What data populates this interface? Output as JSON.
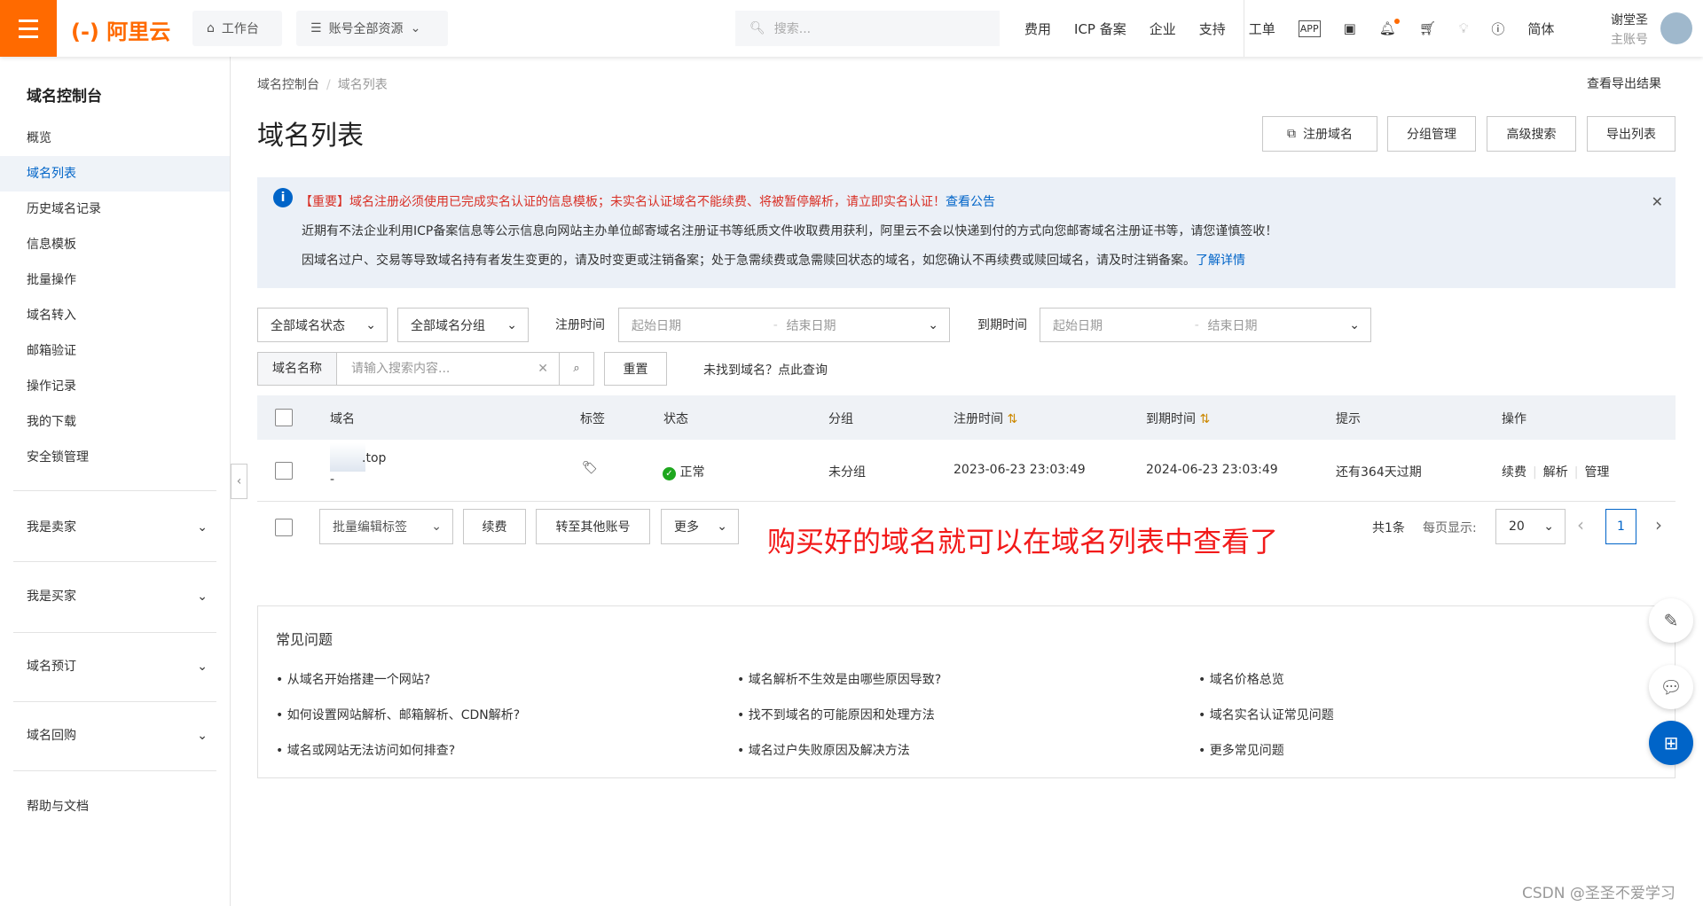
{
  "topbar": {
    "logo": "阿里云",
    "workbench": "工作台",
    "resources": "账号全部资源",
    "search_placeholder": "搜索...",
    "nav": [
      "费用",
      "ICP 备案",
      "企业",
      "支持",
      "工单"
    ],
    "lang": "简体",
    "user_name": "谢堂圣",
    "user_role": "主账号",
    "accent": "#ff6a00"
  },
  "sidebar": {
    "title": "域名控制台",
    "items": [
      "概览",
      "域名列表",
      "历史域名记录",
      "信息模板",
      "批量操作",
      "域名转入",
      "邮箱验证",
      "操作记录",
      "我的下载",
      "安全锁管理"
    ],
    "active": "域名列表",
    "groups": [
      "我是卖家",
      "我是买家",
      "域名预订",
      "域名回购"
    ],
    "help": "帮助与文档"
  },
  "breadcrumb": [
    "域名控制台",
    "域名列表"
  ],
  "page": {
    "title": "域名列表",
    "export_results": "查看导出结果",
    "buttons": [
      "注册域名",
      "分组管理",
      "高级搜索",
      "导出列表"
    ]
  },
  "notice": {
    "line1_important": "【重要】域名注册必须使用已完成实名认证的信息模板；未实名认证域名不能续费、将被暂停解析，请立即实名认证！",
    "line1_link": "查看公告",
    "line2": "近期有不法企业利用ICP备案信息等公示信息向网站主办单位邮寄域名注册证书等纸质文件收取费用获利，阿里云不会以快递到付的方式向您邮寄域名注册证书等，请您谨慎签收！",
    "line3": "因域名过户、交易等导致域名持有者发生变更的，请及时变更或注销备案；处于急需续费或急需赎回状态的域名，如您确认不再续费或赎回域名，请及时注销备案。",
    "line3_link": "了解详情"
  },
  "filters": {
    "status": "全部域名状态",
    "group": "全部域名分组",
    "reg_label": "注册时间",
    "exp_label": "到期时间",
    "start": "起始日期",
    "end": "结束日期",
    "search_label": "域名名称",
    "search_placeholder": "请输入搜索内容...",
    "reset": "重置",
    "not_found": "未找到域名？点此查询"
  },
  "table": {
    "headers": [
      "域名",
      "标签",
      "状态",
      "分组",
      "注册时间",
      "到期时间",
      "提示",
      "操作"
    ],
    "rows": [
      {
        "domain": ".top",
        "sub": "-",
        "status": "正常",
        "group": "未分组",
        "reg": "2023-06-23 23:03:49",
        "exp": "2024-06-23 23:03:49",
        "hint": "还有364天过期",
        "actions": [
          "续费",
          "解析",
          "管理"
        ]
      }
    ]
  },
  "footer": {
    "batch_tag": "批量编辑标签",
    "renew": "续费",
    "transfer": "转至其他账号",
    "more": "更多",
    "total": "共1条",
    "per_page_label": "每页显示:",
    "per_page": "20",
    "page": "1"
  },
  "annotation": "购买好的域名就可以在域名列表中查看了",
  "faq": {
    "title": "常见问题",
    "items": [
      "• 从域名开始搭建一个网站?",
      "• 域名解析不生效是由哪些原因导致?",
      "• 域名价格总览",
      "• 如何设置网站解析、邮箱解析、CDN解析?",
      "• 找不到域名的可能原因和处理方法",
      "• 域名实名认证常见问题",
      "• 域名或网站无法访问如何排查?",
      "• 域名过户失败原因及解决方法",
      "• 更多常见问题"
    ]
  },
  "watermark": "CSDN @圣圣不爱学习"
}
